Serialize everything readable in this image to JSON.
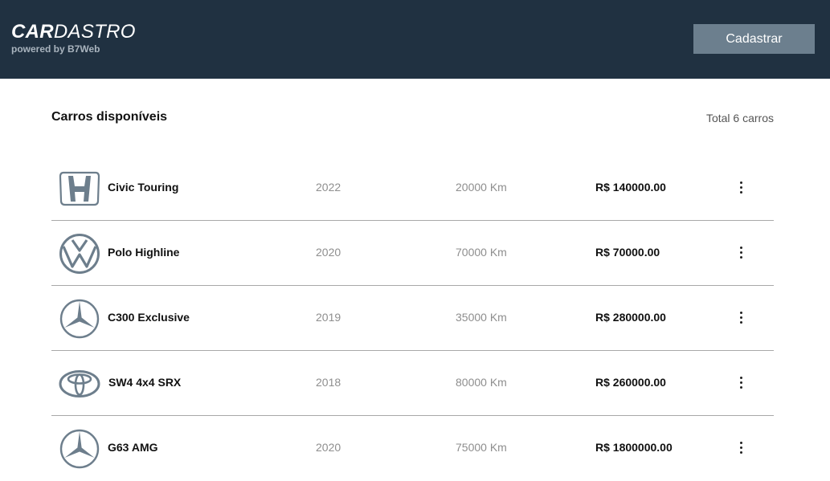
{
  "header": {
    "logo_bold": "CAR",
    "logo_rest": "DASTRO",
    "tagline": "powered by B7Web",
    "cta_label": "Cadastrar"
  },
  "main": {
    "title": "Carros disponíveis",
    "total": "Total 6 carros"
  },
  "cars": [
    {
      "brand_icon": "honda-logo-icon",
      "name": "Civic Touring",
      "year": "2022",
      "km": "20000 Km",
      "price": "R$ 140000.00"
    },
    {
      "brand_icon": "volkswagen-logo-icon",
      "name": "Polo Highline",
      "year": "2020",
      "km": "70000 Km",
      "price": "R$ 70000.00"
    },
    {
      "brand_icon": "mercedes-logo-icon",
      "name": "C300 Exclusive",
      "year": "2019",
      "km": "35000 Km",
      "price": "R$ 280000.00"
    },
    {
      "brand_icon": "toyota-logo-icon",
      "name": "SW4 4x4 SRX",
      "year": "2018",
      "km": "80000 Km",
      "price": "R$ 260000.00"
    },
    {
      "brand_icon": "mercedes-logo-icon",
      "name": "G63 AMG",
      "year": "2020",
      "km": "75000 Km",
      "price": "R$ 1800000.00"
    }
  ],
  "colors": {
    "header_bg": "#203141",
    "button_bg": "#6c7f8e",
    "logo_icon": "#6d7e8c"
  }
}
